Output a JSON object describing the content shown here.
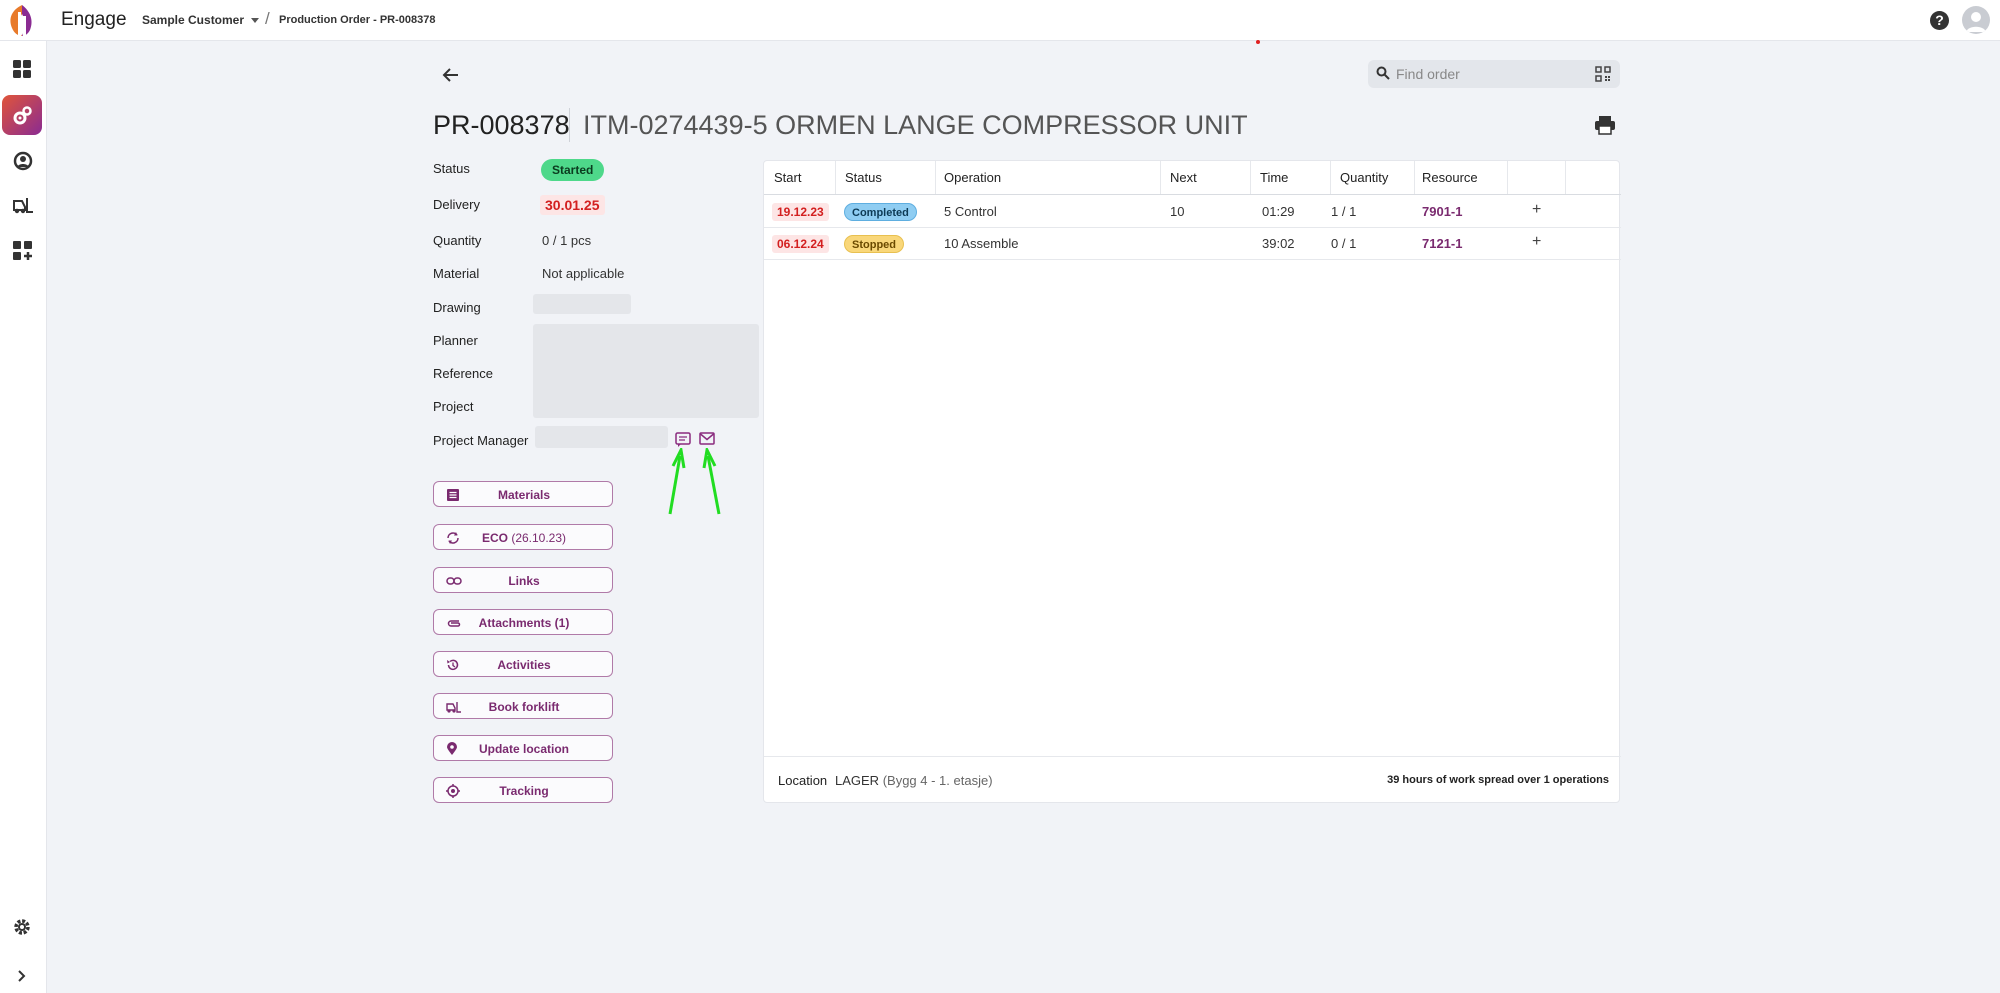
{
  "app": {
    "brand": "Engage",
    "customer": "Sample Customer",
    "breadcrumb": "Production Order - PR-008378"
  },
  "search": {
    "placeholder": "Find order"
  },
  "order": {
    "id": "PR-008378",
    "item": "ITM-0274439-5 ORMEN LANGE COMPRESSOR UNIT",
    "fields": {
      "status_label": "Status",
      "status_value": "Started",
      "delivery_label": "Delivery",
      "delivery_value": "30.01.25",
      "quantity_label": "Quantity",
      "quantity_value": "0 / 1 pcs",
      "material_label": "Material",
      "material_value": "Not applicable",
      "drawing_label": "Drawing",
      "planner_label": "Planner",
      "reference_label": "Reference",
      "project_label": "Project",
      "pm_label": "Project Manager"
    }
  },
  "actions": [
    {
      "label": "Materials",
      "suffix": "",
      "icon": "list-icon"
    },
    {
      "label": "ECO",
      "suffix": " (26.10.23)",
      "icon": "sync-icon"
    },
    {
      "label": "Links",
      "suffix": "",
      "icon": "link-icon"
    },
    {
      "label": "Attachments (1)",
      "suffix": "",
      "icon": "attachment-icon"
    },
    {
      "label": "Activities",
      "suffix": "",
      "icon": "history-icon"
    },
    {
      "label": "Book forklift",
      "suffix": "",
      "icon": "forklift-icon"
    },
    {
      "label": "Update location",
      "suffix": "",
      "icon": "location-pin-icon"
    },
    {
      "label": "Tracking",
      "suffix": "",
      "icon": "target-icon"
    }
  ],
  "table": {
    "headers": [
      "Start",
      "Status",
      "Operation",
      "Next",
      "Time",
      "Quantity",
      "Resource"
    ],
    "rows": [
      {
        "start": "19.12.23",
        "status": "Completed",
        "operation": "5 Control",
        "next": "10",
        "time": "01:29",
        "quantity": "1 / 1",
        "resource": "7901-1"
      },
      {
        "start": "06.12.24",
        "status": "Stopped",
        "operation": "10 Assemble",
        "next": "",
        "time": "39:02",
        "quantity": "0 / 1",
        "resource": "7121-1"
      }
    ],
    "plus": "+"
  },
  "footer": {
    "location_label": "Location",
    "location_value": "LAGER",
    "location_detail": "(Bygg 4 - 1. etasje)",
    "summary": "39 hours of work spread over 1 operations"
  },
  "colors": {
    "accent": "#7a2a6f",
    "started": "#4ed88a",
    "overdue": "#d32020",
    "completed": "#8fcdf2",
    "stopped": "#f9d77a"
  }
}
